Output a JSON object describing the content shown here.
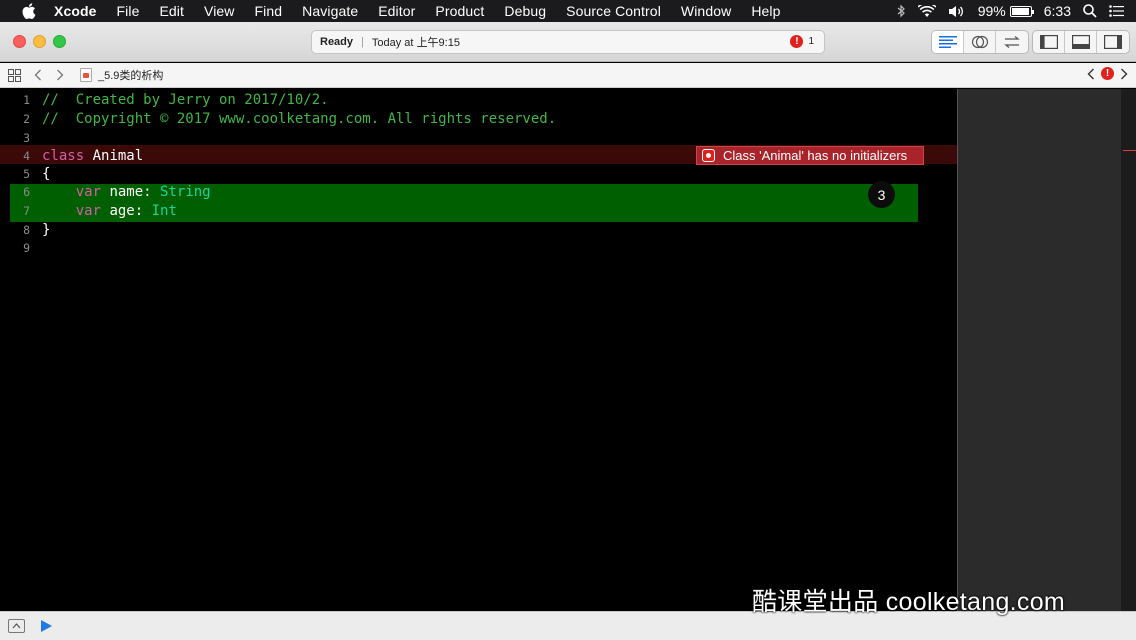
{
  "menubar": {
    "items": [
      "Xcode",
      "File",
      "Edit",
      "View",
      "Find",
      "Navigate",
      "Editor",
      "Product",
      "Debug",
      "Source Control",
      "Window",
      "Help"
    ],
    "battery_percent": "99%",
    "clock": "6:33"
  },
  "toolbar": {
    "status": "Ready",
    "timestamp": "Today at 上午9:15",
    "error_count": "1",
    "error_glyph": "!"
  },
  "jumpbar": {
    "file_name": "_5.9类的析构",
    "error_glyph": "!"
  },
  "editor": {
    "line_numbers": [
      "1",
      "2",
      "3",
      "4",
      "5",
      "6",
      "7",
      "8",
      "9"
    ],
    "lines": {
      "l1": "//  Created by Jerry on 2017/10/2.",
      "l2": "//  Copyright © 2017 www.coolketang.com. All rights reserved.",
      "l4_kw": "class",
      "l4_name": " Animal",
      "l5": "{",
      "l6_kw": "    var",
      "l6_name": " name: ",
      "l6_type": "String",
      "l7_kw": "    var",
      "l7_name": " age: ",
      "l7_type": "Int",
      "l8": "}"
    },
    "error_message": "Class 'Animal' has no initializers",
    "step_badge": "3"
  },
  "watermark": "酷课堂出品 coolketang.com",
  "colors": {
    "comment": "#41b645",
    "keyword": "#d45fa7",
    "type": "#1bd3a3",
    "highlight": "#005f00",
    "error": "#a9232a"
  }
}
